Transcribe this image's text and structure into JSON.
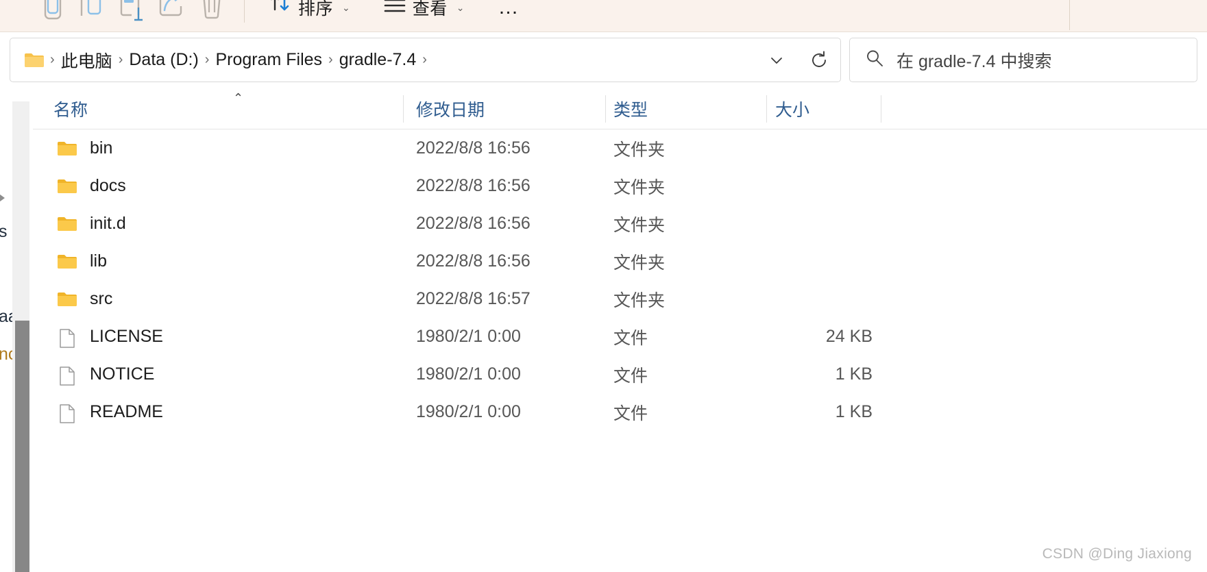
{
  "toolbar": {
    "icons": [
      {
        "name": "cut-icon",
        "label": "剪切"
      },
      {
        "name": "copy-icon",
        "label": "复制"
      },
      {
        "name": "paste-icon",
        "label": "粘贴"
      },
      {
        "name": "share-icon",
        "label": "共享"
      },
      {
        "name": "delete-icon",
        "label": "删除"
      }
    ],
    "sort_label": "排序",
    "view_label": "查看",
    "more_label": "…"
  },
  "address": {
    "folder_icon": "folder-icon",
    "crumbs": [
      "此电脑",
      "Data (D:)",
      "Program Files",
      "gradle-7.4"
    ],
    "separator": "›",
    "dropdown_icon": "chevron-down-icon",
    "refresh_icon": "refresh-icon"
  },
  "search": {
    "icon": "search-icon",
    "placeholder": "在 gradle-7.4 中搜索"
  },
  "columns": [
    {
      "key": "name",
      "label": "名称",
      "sorted": true,
      "sort_caret": "⌃"
    },
    {
      "key": "date",
      "label": "修改日期",
      "sorted": false,
      "sort_caret": ""
    },
    {
      "key": "type",
      "label": "类型",
      "sorted": false,
      "sort_caret": ""
    },
    {
      "key": "size",
      "label": "大小",
      "sorted": false,
      "sort_caret": ""
    }
  ],
  "files": [
    {
      "name": "bin",
      "icon": "folder-icon",
      "date": "2022/8/8 16:56",
      "type": "文件夹",
      "size": ""
    },
    {
      "name": "docs",
      "icon": "folder-icon",
      "date": "2022/8/8 16:56",
      "type": "文件夹",
      "size": ""
    },
    {
      "name": "init.d",
      "icon": "folder-icon",
      "date": "2022/8/8 16:56",
      "type": "文件夹",
      "size": ""
    },
    {
      "name": "lib",
      "icon": "folder-icon",
      "date": "2022/8/8 16:56",
      "type": "文件夹",
      "size": ""
    },
    {
      "name": "src",
      "icon": "folder-icon",
      "date": "2022/8/8 16:57",
      "type": "文件夹",
      "size": ""
    },
    {
      "name": "LICENSE",
      "icon": "file-icon",
      "date": "1980/2/1 0:00",
      "type": "文件",
      "size": "24 KB"
    },
    {
      "name": "NOTICE",
      "icon": "file-icon",
      "date": "1980/2/1 0:00",
      "type": "文件",
      "size": "1 KB"
    },
    {
      "name": "README",
      "icon": "file-icon",
      "date": "1980/2/1 0:00",
      "type": "文件",
      "size": "1 KB"
    }
  ],
  "nav_ghost": [
    "s",
    "aa",
    "nc"
  ],
  "watermark": "CSDN @Ding Jiaxiong",
  "colors": {
    "toolbar_bg": "#faf2ec",
    "folder_yellow": "#f7c24b",
    "header_text": "#2f5c8f",
    "accent_blue": "#8cc0e8"
  }
}
